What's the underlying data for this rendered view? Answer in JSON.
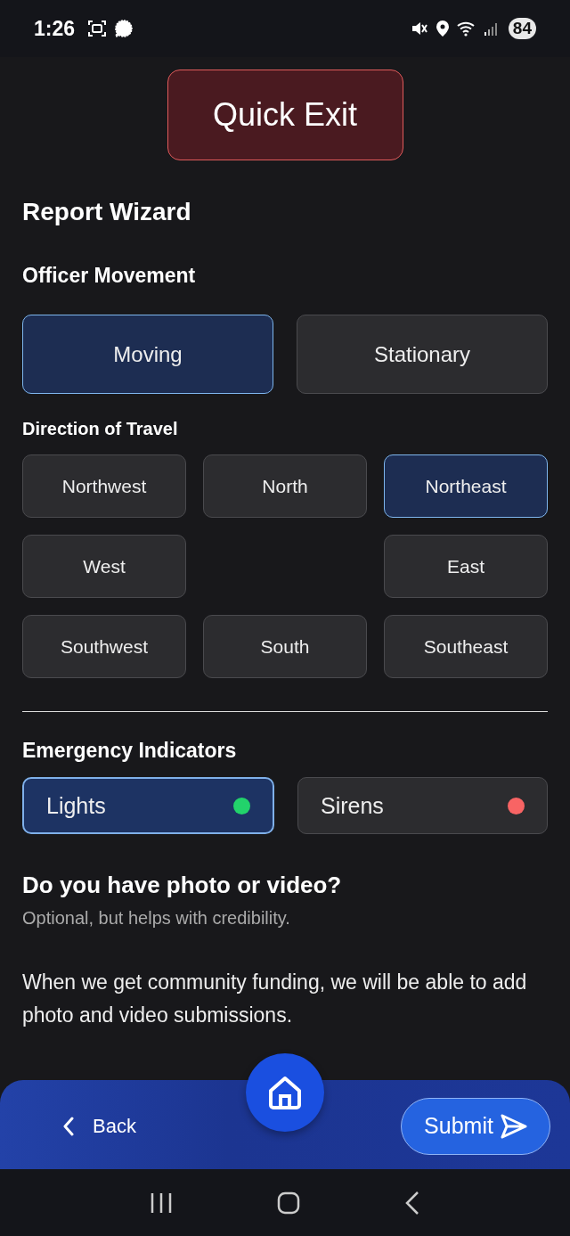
{
  "status_bar": {
    "time": "1:26",
    "battery": "84"
  },
  "quick_exit": {
    "label": "Quick Exit"
  },
  "title": "Report Wizard",
  "movement": {
    "heading": "Officer Movement",
    "options": [
      {
        "label": "Moving",
        "selected": true
      },
      {
        "label": "Stationary",
        "selected": false
      }
    ]
  },
  "direction": {
    "heading": "Direction of Travel",
    "rows": [
      {
        "items": [
          {
            "label": "Northwest",
            "selected": false
          },
          {
            "label": "North",
            "selected": false
          },
          {
            "label": "Northeast",
            "selected": true
          }
        ]
      },
      {
        "items": [
          {
            "label": "West",
            "selected": false
          },
          {
            "label": "East",
            "selected": false
          }
        ]
      },
      {
        "items": [
          {
            "label": "Southwest",
            "selected": false
          },
          {
            "label": "South",
            "selected": false
          },
          {
            "label": "Southeast",
            "selected": false
          }
        ]
      }
    ]
  },
  "indicators": {
    "heading": "Emergency Indicators",
    "items": [
      {
        "label": "Lights",
        "selected": true,
        "color": "#22d36b"
      },
      {
        "label": "Sirens",
        "selected": false,
        "color": "#f86464"
      }
    ]
  },
  "media": {
    "question": "Do you have photo or video?",
    "hint": "Optional, but helps with credibility.",
    "note": "When we get community funding, we will be able to add photo and video submissions."
  },
  "bottom_bar": {
    "back": "Back",
    "submit": "Submit"
  }
}
